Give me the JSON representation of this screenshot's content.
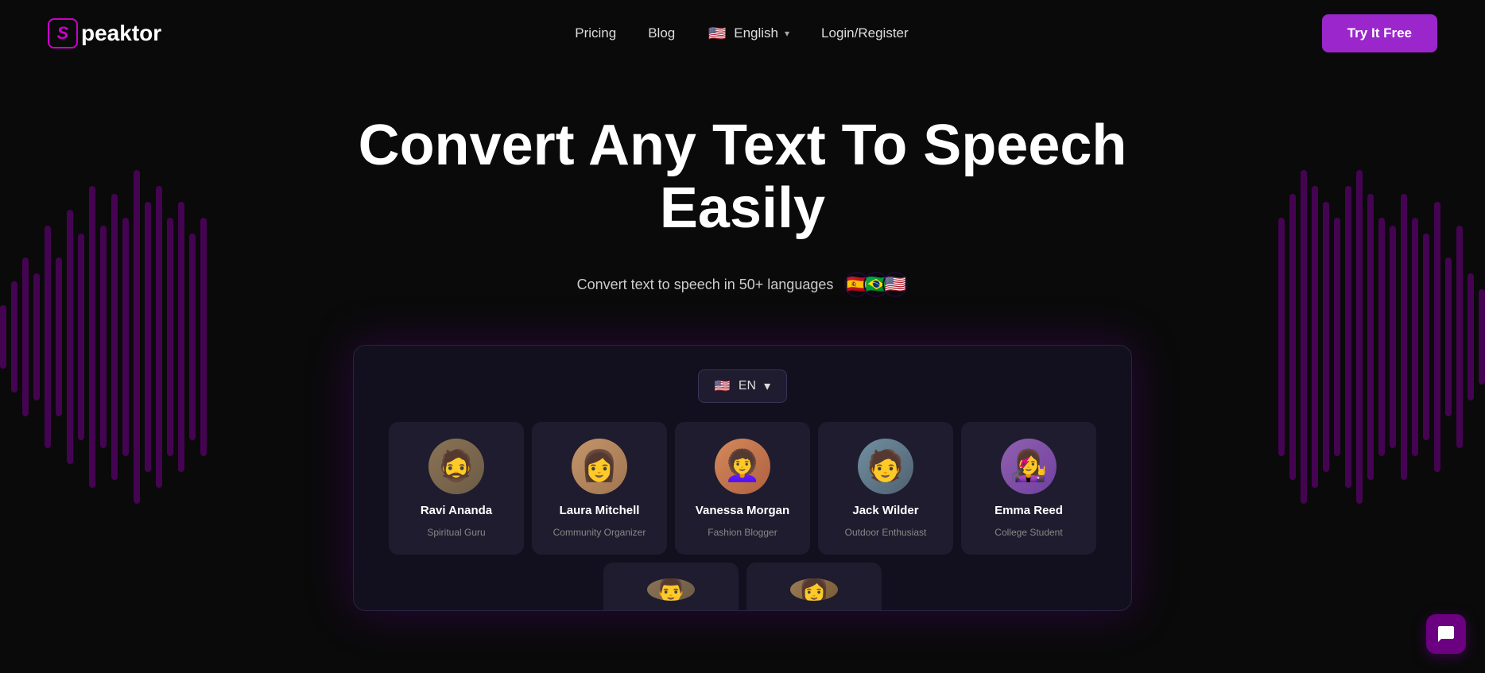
{
  "navbar": {
    "logo_letter": "S",
    "logo_name": "peaktor",
    "pricing_label": "Pricing",
    "blog_label": "Blog",
    "language_label": "English",
    "login_label": "Login/Register",
    "try_free_label": "Try It Free"
  },
  "hero": {
    "title": "Convert Any Text To Speech Easily",
    "subtitle": "Convert text to speech in 50+ languages",
    "flags": [
      "🇪🇸",
      "🇧🇷",
      "🇺🇸"
    ]
  },
  "app_demo": {
    "lang_selector": {
      "flag": "🇺🇸",
      "code": "EN",
      "chevron": "▼"
    },
    "voice_cards": [
      {
        "id": "ravi",
        "name": "Ravi Ananda",
        "role": "Spiritual Guru",
        "avatar_class": "av-ravi",
        "emoji": "🧔"
      },
      {
        "id": "laura",
        "name": "Laura Mitchell",
        "role": "Community Organizer",
        "avatar_class": "av-laura",
        "emoji": "👩"
      },
      {
        "id": "vanessa",
        "name": "Vanessa Morgan",
        "role": "Fashion Blogger",
        "avatar_class": "av-vanessa",
        "emoji": "👩‍🦱"
      },
      {
        "id": "jack",
        "name": "Jack Wilder",
        "role": "Outdoor Enthusiast",
        "avatar_class": "av-jack",
        "emoji": "🧑"
      },
      {
        "id": "emma",
        "name": "Emma Reed",
        "role": "College Student",
        "avatar_class": "av-emma",
        "emoji": "👩‍🎤"
      }
    ],
    "partial_cards": [
      {
        "id": "partial1",
        "avatar_class": "av-partial1",
        "emoji": "👨"
      },
      {
        "id": "partial2",
        "avatar_class": "av-partial2",
        "emoji": "👩"
      }
    ]
  },
  "wave_bars": {
    "left_heights": [
      80,
      140,
      200,
      160,
      280,
      200,
      320,
      260,
      380,
      280,
      360,
      300,
      420,
      340,
      380,
      300,
      340,
      260,
      300
    ],
    "right_heights": [
      300,
      360,
      420,
      380,
      340,
      300,
      380,
      420,
      360,
      300,
      280,
      360,
      300,
      260,
      340,
      200,
      280,
      160,
      120
    ]
  },
  "chat_btn": {
    "icon": "💬"
  }
}
